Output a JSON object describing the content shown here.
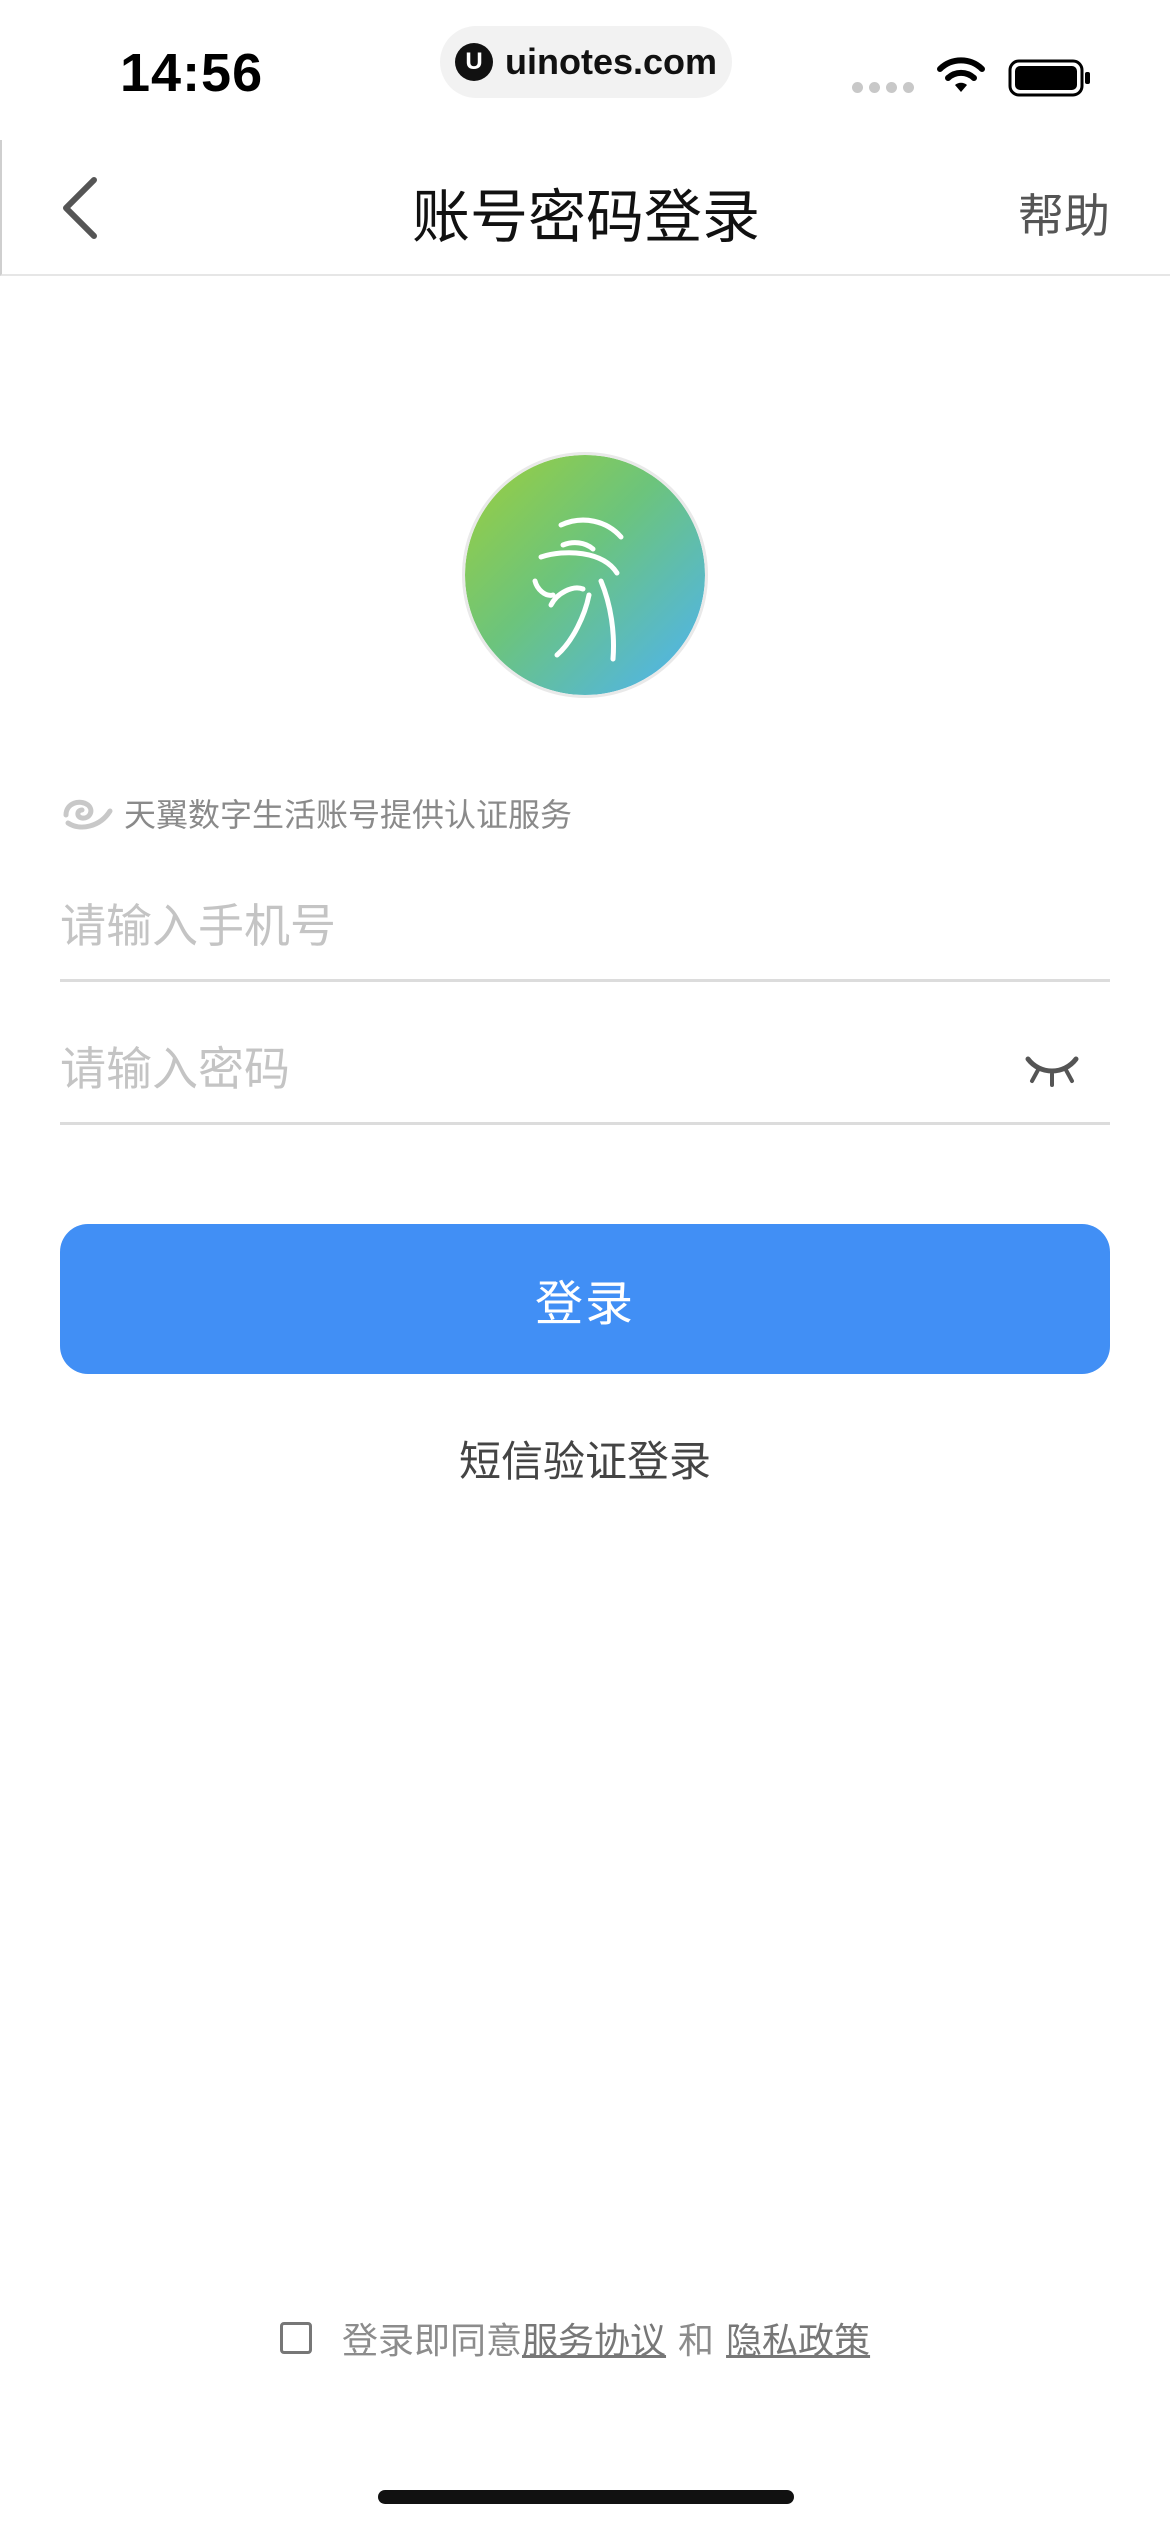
{
  "status_bar": {
    "time": "14:56",
    "url_icon_letter": "U",
    "url": "uinotes.com"
  },
  "nav": {
    "title": "账号密码登录",
    "help": "帮助"
  },
  "provider": {
    "text": "天翼数字生活账号提供认证服务"
  },
  "form": {
    "phone_placeholder": "请输入手机号",
    "password_placeholder": "请输入密码",
    "login_button": "登录",
    "sms_login": "短信验证登录"
  },
  "agreement": {
    "prefix": "登录即同意",
    "service_link": "服务协议",
    "and": "和",
    "privacy_link": "隐私政策"
  },
  "colors": {
    "primary": "#418ff5",
    "logo_green": "#8fd044",
    "logo_blue": "#54b6f5"
  }
}
